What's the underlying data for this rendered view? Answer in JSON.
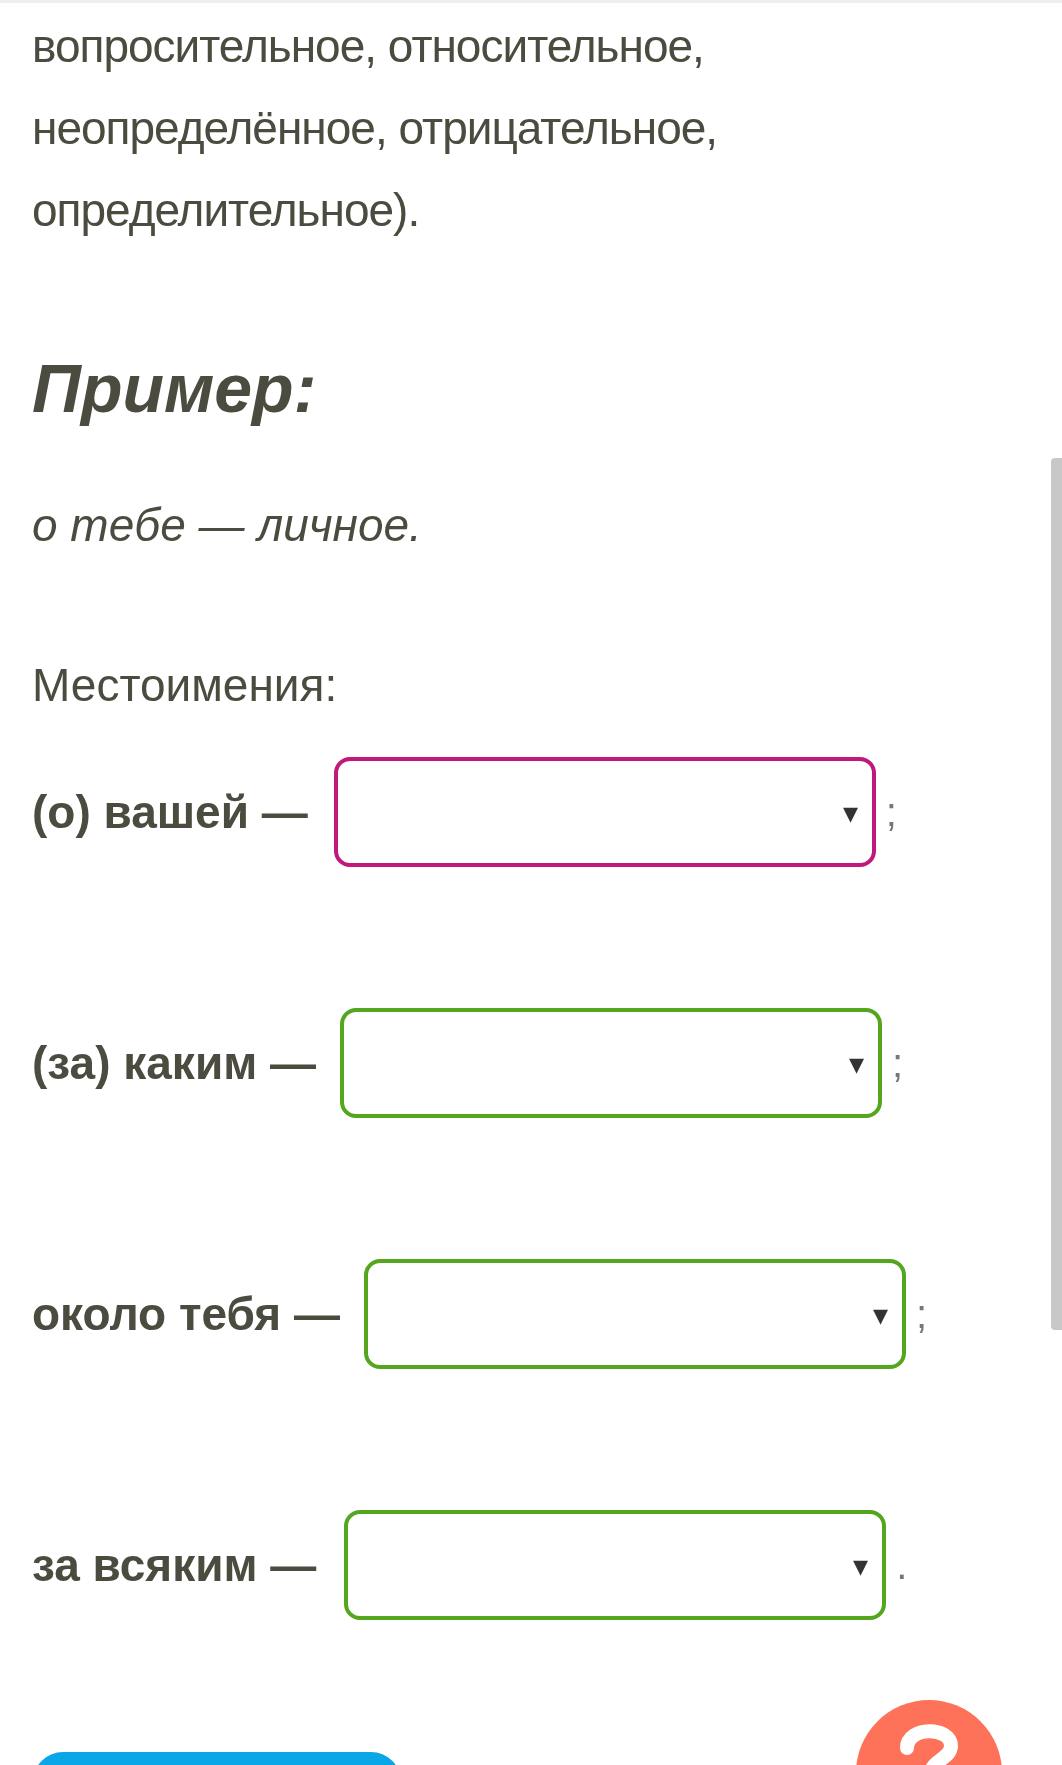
{
  "intro_lines": [
    "вопросительное, относительное,",
    "неопределённое, отрицательное,",
    "определительное)."
  ],
  "example": {
    "heading": "Пример:",
    "text": "о тебе — личное."
  },
  "pronouns_label": "Местоимения:",
  "rows": [
    {
      "word": "(о) вашей —",
      "focused": true,
      "end": ";"
    },
    {
      "word": "(за) каким —",
      "focused": false,
      "end": ";"
    },
    {
      "word": "около тебя —",
      "focused": false,
      "end": ";"
    },
    {
      "word": "за всяким —",
      "focused": false,
      "end": "."
    }
  ],
  "select_arrow": "▾"
}
